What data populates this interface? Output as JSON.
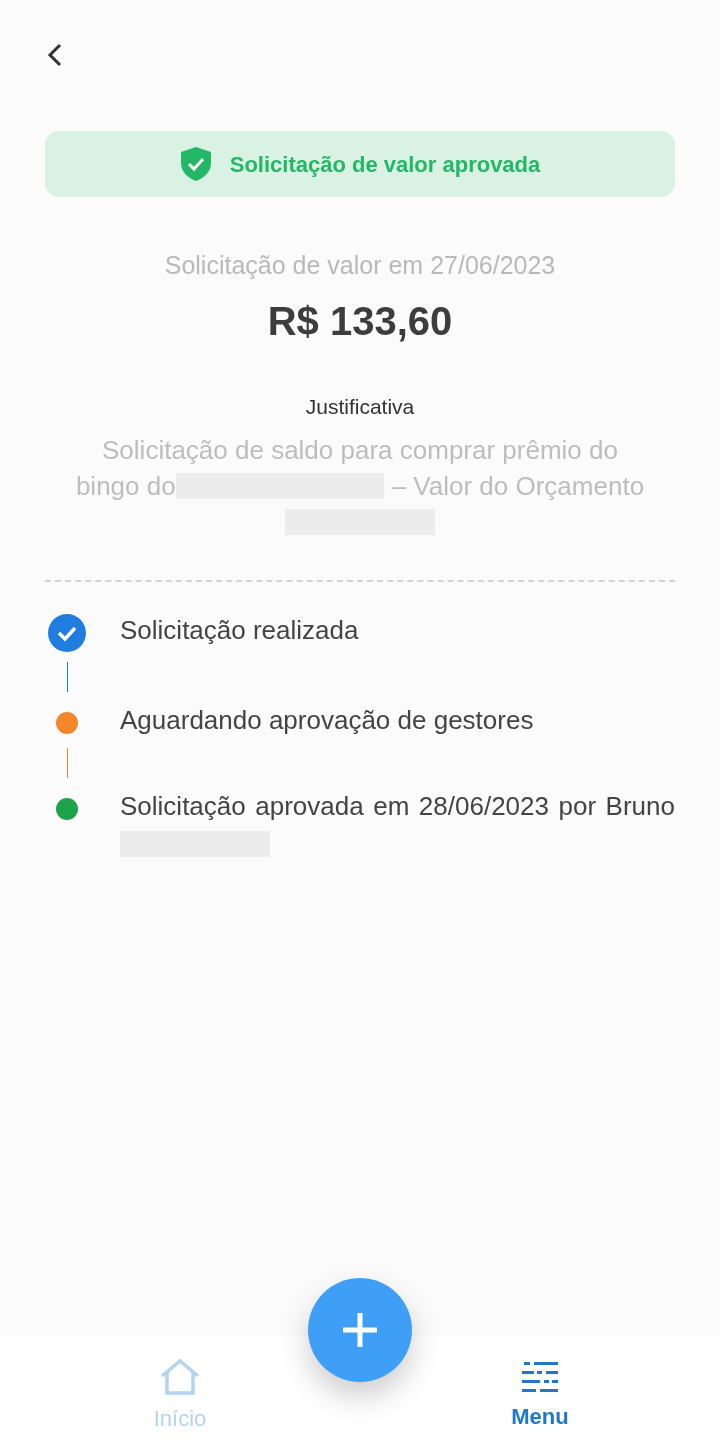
{
  "banner": {
    "text": "Solicitação de valor aprovada"
  },
  "request": {
    "date_line": "Solicitação de valor em 27/06/2023",
    "amount": "R$ 133,60"
  },
  "justification": {
    "label": "Justificativa",
    "line_1": "Solicitação de saldo para comprar prêmio do",
    "line_2_start": "bingo do",
    "line_2_end": "– Valor do Orçamento"
  },
  "timeline": [
    {
      "kind": "check",
      "color": "#1f7de0",
      "text": "Solicitação realizada"
    },
    {
      "kind": "dot",
      "color": "#f5862a",
      "text": "Aguardando aprovação de gestores"
    },
    {
      "kind": "dot",
      "color": "#1ea34a",
      "text": "Solicitação aprovada em 28/06/2023 por Bruno",
      "redacted_tail": true
    }
  ],
  "nav": [
    {
      "label": "Início",
      "kind": "home",
      "selected": false
    },
    {
      "label": "Menu",
      "kind": "menu",
      "selected": true
    }
  ]
}
